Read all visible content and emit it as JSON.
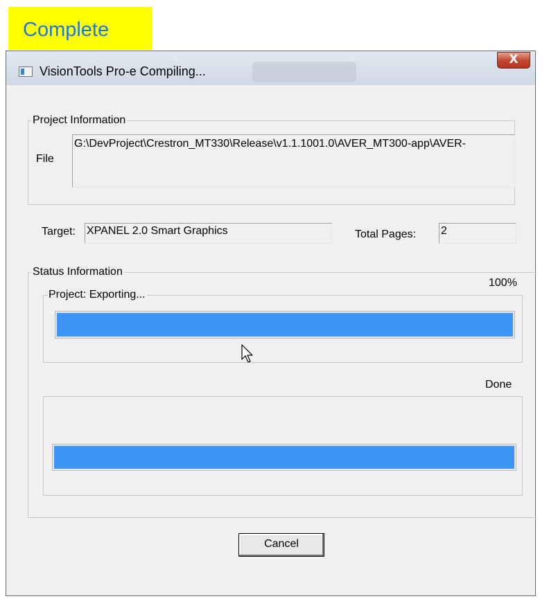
{
  "banner": {
    "label": "Complete"
  },
  "window": {
    "title": "VisionTools Pro-e Compiling...",
    "close_glyph": "X"
  },
  "project_info": {
    "legend": "Project Information",
    "file_label": "File",
    "file_value": "G:\\DevProject\\Crestron_MT330\\Release\\v1.1.1001.0\\AVER_MT300-app\\AVER-"
  },
  "target": {
    "label": "Target:",
    "value": "XPANEL 2.0 Smart Graphics",
    "total_pages_label": "Total Pages:",
    "total_pages_value": "2"
  },
  "status": {
    "legend": "Status Information",
    "percent_text": "100%",
    "project_legend": "Project: Exporting...",
    "project_progress": 1.0,
    "done_text": "Done",
    "overall_progress": 1.0
  },
  "buttons": {
    "cancel": "Cancel"
  },
  "colors": {
    "banner_bg": "#ffff00",
    "banner_text": "#1e78d6",
    "progress": "#3d95f5"
  },
  "icons": [
    "window-app-icon",
    "close-icon",
    "mouse-pointer-icon"
  ]
}
